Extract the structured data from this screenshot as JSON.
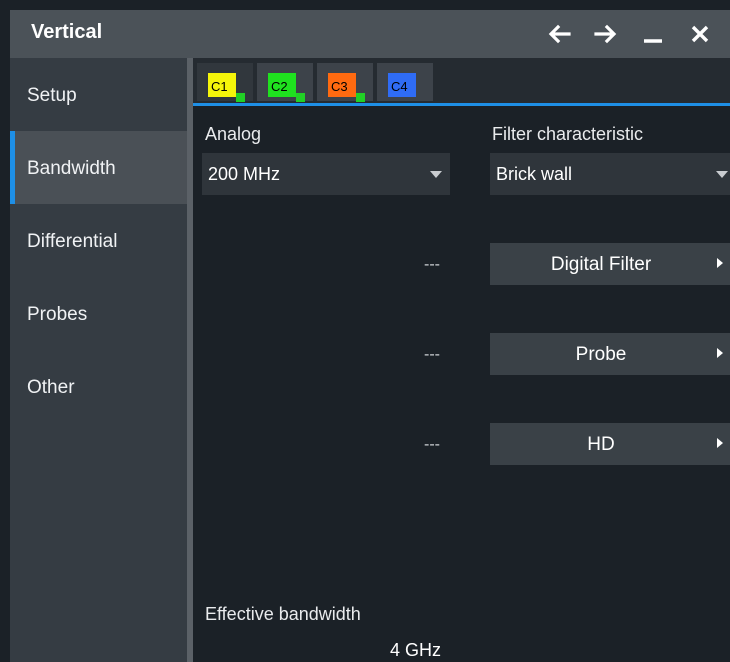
{
  "window": {
    "title": "Vertical",
    "buttons": [
      {
        "name": "back-arrow-icon"
      },
      {
        "name": "forward-arrow-icon"
      },
      {
        "name": "minimize-icon"
      },
      {
        "name": "close-icon"
      }
    ]
  },
  "sidebar": {
    "items": [
      {
        "label": "Setup",
        "active": false
      },
      {
        "label": "Bandwidth",
        "active": true
      },
      {
        "label": "Differential",
        "active": false
      },
      {
        "label": "Probes",
        "active": false
      },
      {
        "label": "Other",
        "active": false
      }
    ],
    "accent_color": "#1e8fe6"
  },
  "channels": [
    {
      "label": "C1",
      "color": "#f5f50a",
      "active": true,
      "on": true
    },
    {
      "label": "C2",
      "color": "#1fe11f",
      "active": false,
      "on": true
    },
    {
      "label": "C3",
      "color": "#ff6a10",
      "active": false,
      "on": true
    },
    {
      "label": "C4",
      "color": "#2f6cf5",
      "active": false,
      "on": false
    }
  ],
  "bandwidth": {
    "analog_label": "Analog",
    "analog_value": "200 MHz",
    "filter_label": "Filter characteristic",
    "filter_value": "Brick wall",
    "rows": [
      {
        "value": "---",
        "button": "Digital Filter"
      },
      {
        "value": "---",
        "button": "Probe"
      },
      {
        "value": "---",
        "button": "HD"
      }
    ],
    "effective_label": "Effective bandwidth",
    "effective_value": "4 GHz"
  }
}
